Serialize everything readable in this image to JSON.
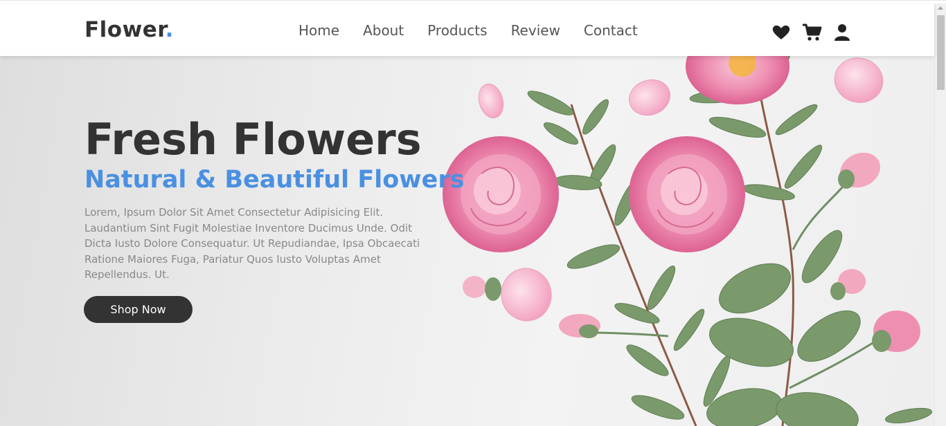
{
  "brand": {
    "name": "Flower",
    "dot": "."
  },
  "nav": {
    "items": [
      {
        "label": "Home"
      },
      {
        "label": "About"
      },
      {
        "label": "Products"
      },
      {
        "label": "Review"
      },
      {
        "label": "Contact"
      }
    ]
  },
  "header_icons": [
    "heart-icon",
    "shopping-cart-icon",
    "user-icon"
  ],
  "hero": {
    "title": "Fresh Flowers",
    "subtitle": "Natural & Beautiful Flowers",
    "description": "Lorem, Ipsum Dolor Sit Amet Consectetur Adipisicing Elit. Laudantium Sint Fugit Molestiae Inventore Ducimus Unde. Odit Dicta Iusto Dolore Consequatur. Ut Repudiandae, Ipsa Obcaecati Ratione Maiores Fuga, Pariatur Quos Iusto Voluptas Amet Repellendus. Ut.",
    "cta_label": "Shop Now"
  },
  "colors": {
    "accent": "#4a90e2",
    "text_dark": "#333333",
    "text_muted": "#888888",
    "button_bg": "#333333",
    "rose": "#ef8fb3",
    "leaf": "#6f8f64"
  }
}
